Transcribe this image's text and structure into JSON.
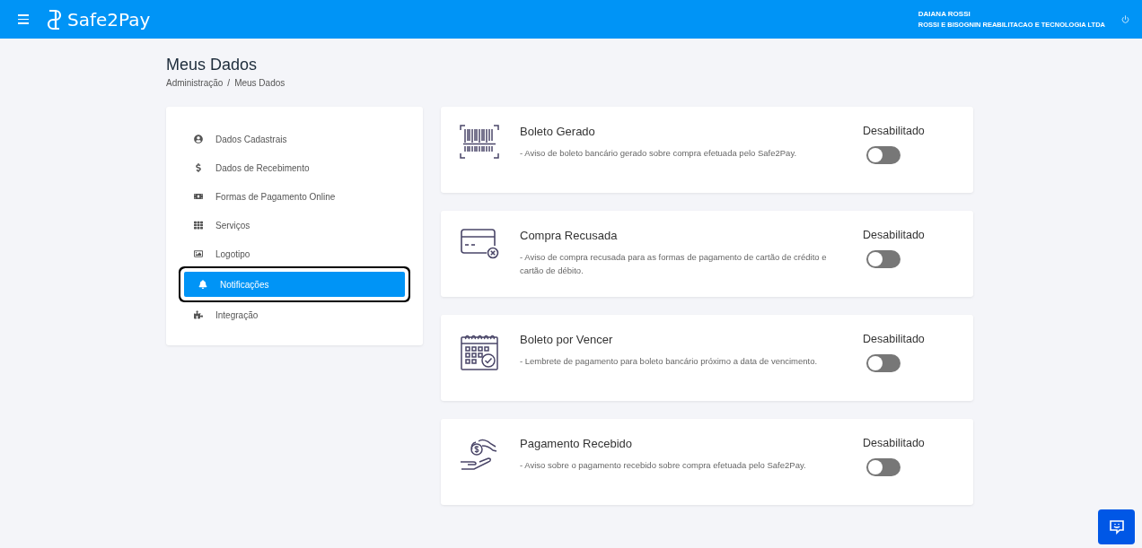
{
  "header": {
    "brand": "Safe2Pay",
    "user_name": "DAIANA ROSSI",
    "company": "ROSSI E BISOGNIN REABILITACAO E TECNOLOGIA LTDA"
  },
  "page": {
    "title": "Meus Dados",
    "breadcrumb": [
      "Administração",
      "Meus Dados"
    ],
    "breadcrumb_separator": "/"
  },
  "sidebar": {
    "items": [
      {
        "label": "Dados Cadastrais",
        "selected": false
      },
      {
        "label": "Dados de Recebimento",
        "selected": false
      },
      {
        "label": "Formas de Pagamento Online",
        "selected": false
      },
      {
        "label": "Serviços",
        "selected": false
      },
      {
        "label": "Logotipo",
        "selected": false
      },
      {
        "label": "Notificações",
        "selected": true
      },
      {
        "label": "Integração",
        "selected": false
      }
    ]
  },
  "notifications": [
    {
      "kind": "barcode",
      "title": "Boleto Gerado",
      "description": "- Aviso de boleto bancário gerado sobre compra efetuada pelo Safe2Pay.",
      "status": "Desabilitado",
      "on": false
    },
    {
      "kind": "card",
      "title": "Compra Recusada",
      "description": "- Aviso de compra recusada para as formas de pagamento de cartão de crédito e cartão de débito.",
      "status": "Desabilitado",
      "on": false
    },
    {
      "kind": "calendar",
      "title": "Boleto por Vencer",
      "description": "- Lembrete de pagamento para boleto bancário próximo a data de vencimento.",
      "status": "Desabilitado",
      "on": false
    },
    {
      "kind": "hand",
      "title": "Pagamento Recebido",
      "description": "- Aviso sobre o pagamento recebido sobre compra efetuada pelo Safe2Pay.",
      "status": "Desabilitado",
      "on": false
    }
  ]
}
